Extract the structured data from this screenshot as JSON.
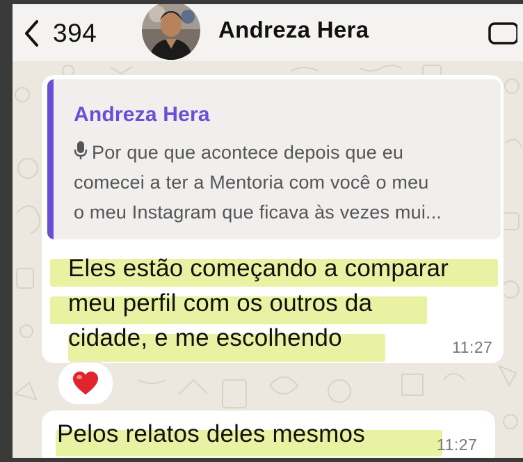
{
  "header": {
    "back_count": "394",
    "contact_name": "Andreza Hera",
    "icons": {
      "back": "chevron-left-icon",
      "video": "video-camera-icon"
    }
  },
  "messages": [
    {
      "reply": {
        "author": "Andreza Hera",
        "icon": "microphone-icon",
        "text_lines": [
          "Por que que acontece depois que eu",
          "comecei a ter a Mentoria com você o meu",
          "o meu Instagram que ficava às vezes mui..."
        ]
      },
      "lines": [
        "Eles estão começando a comparar",
        "meu perfil com os outros da",
        "cidade, e me escolhendo"
      ],
      "time": "11:27",
      "reaction": "❤️"
    },
    {
      "lines": [
        "Pelos relatos deles mesmos"
      ],
      "time": "11:27"
    }
  ],
  "colors": {
    "accent": "#6a4fd6",
    "highlight": "#e9f2a2",
    "chat_background": "#ece7df",
    "bubble": "#ffffff"
  }
}
